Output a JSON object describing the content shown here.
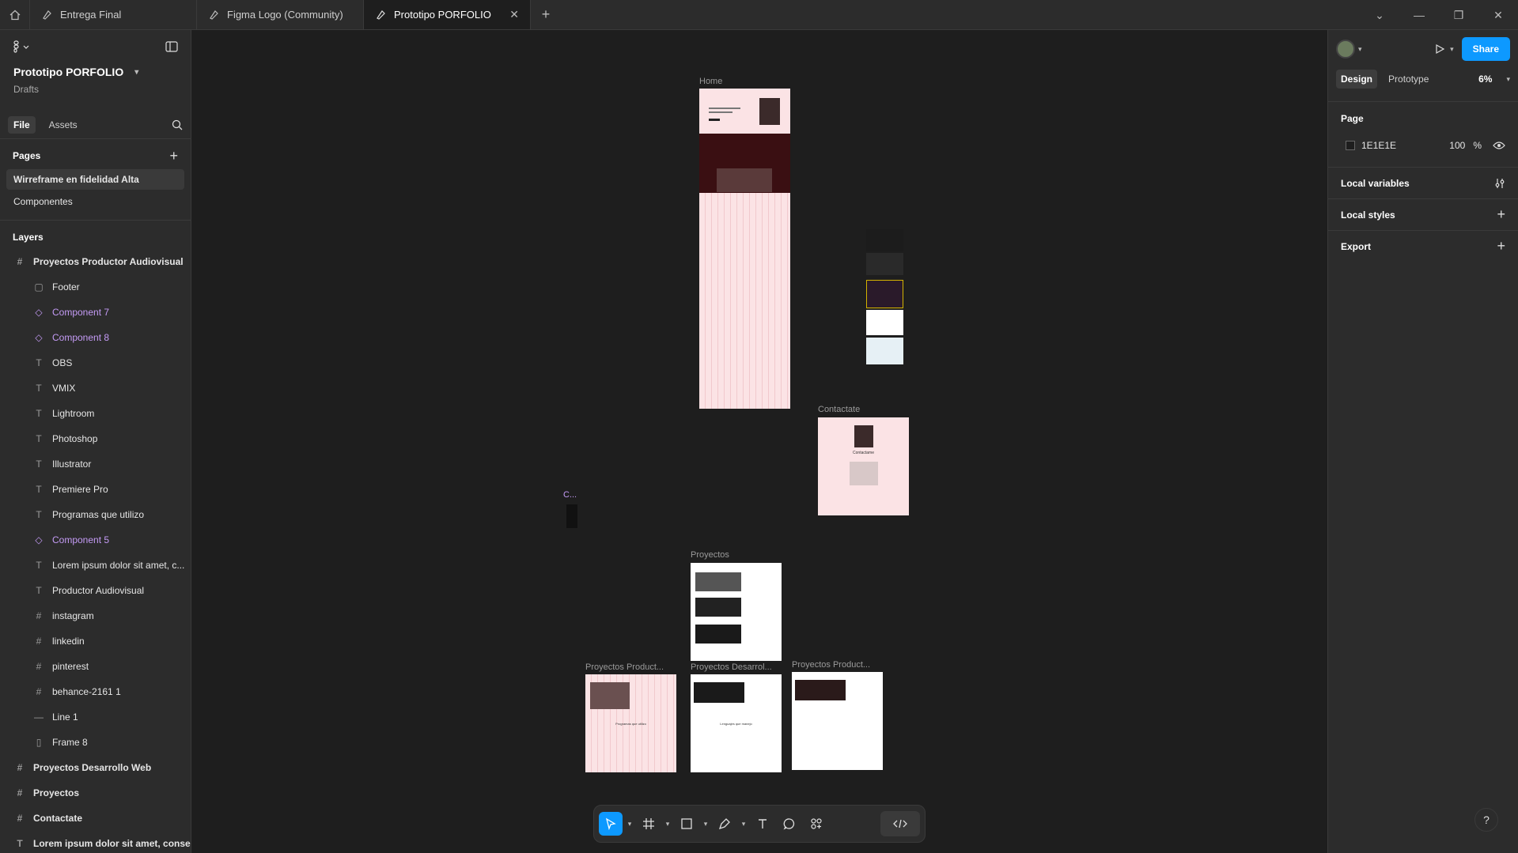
{
  "tabs": [
    {
      "label": "Entrega Final",
      "active": false
    },
    {
      "label": "Figma Logo (Community)",
      "active": false
    },
    {
      "label": "Prototipo PORFOLIO",
      "active": true
    }
  ],
  "left_panel": {
    "file_title": "Prototipo PORFOLIO",
    "file_subtitle": "Drafts",
    "tabs": {
      "file": "File",
      "assets": "Assets"
    },
    "pages_title": "Pages",
    "pages": [
      {
        "label": "Wirreframe en fidelidad Alta",
        "active": true
      },
      {
        "label": "Componentes",
        "active": false
      }
    ],
    "layers_title": "Layers",
    "layers": [
      {
        "label": "Proyectos Productor Audiovisual",
        "type": "frame",
        "level": 0
      },
      {
        "label": "Footer",
        "type": "rect",
        "level": 1
      },
      {
        "label": "Component 7",
        "type": "component",
        "level": 1
      },
      {
        "label": "Component 8",
        "type": "component",
        "level": 1
      },
      {
        "label": "OBS",
        "type": "text",
        "level": 1
      },
      {
        "label": "VMIX",
        "type": "text",
        "level": 1
      },
      {
        "label": "Lightroom",
        "type": "text",
        "level": 1
      },
      {
        "label": "Photoshop",
        "type": "text",
        "level": 1
      },
      {
        "label": "Illustrator",
        "type": "text",
        "level": 1
      },
      {
        "label": "Premiere Pro",
        "type": "text",
        "level": 1
      },
      {
        "label": "Programas que utilizo",
        "type": "text",
        "level": 1
      },
      {
        "label": "Component 5",
        "type": "component",
        "level": 1
      },
      {
        "label": "Lorem ipsum dolor sit amet, c...",
        "type": "text",
        "level": 1
      },
      {
        "label": "Productor Audiovisual",
        "type": "text",
        "level": 1
      },
      {
        "label": "instagram",
        "type": "frame",
        "level": 1
      },
      {
        "label": "linkedin",
        "type": "frame",
        "level": 1
      },
      {
        "label": "pinterest",
        "type": "frame",
        "level": 1
      },
      {
        "label": "behance-2161 1",
        "type": "frame",
        "level": 1
      },
      {
        "label": "Line 1",
        "type": "line",
        "level": 1
      },
      {
        "label": "Frame 8",
        "type": "autolayout",
        "level": 1
      },
      {
        "label": "Proyectos Desarrollo Web",
        "type": "frame",
        "level": 0
      },
      {
        "label": "Proyectos",
        "type": "frame",
        "level": 0
      },
      {
        "label": "Contactate",
        "type": "frame",
        "level": 0
      },
      {
        "label": "Lorem ipsum dolor sit amet, conse...",
        "type": "text",
        "level": 0
      }
    ]
  },
  "canvas": {
    "frames": {
      "home": "Home",
      "contactate": "Contactate",
      "proyectos": "Proyectos",
      "proy_product": "Proyectos Product...",
      "proy_desarrollo": "Proyectos Desarrol...",
      "proy_product2": "Proyectos Product...",
      "component": "C..."
    },
    "contact_heading": "Contactame",
    "programs_heading": "Programas que utilizo",
    "languages_heading": "Lenguajes que manejo"
  },
  "right_panel": {
    "share": "Share",
    "tabs": {
      "design": "Design",
      "prototype": "Prototype"
    },
    "zoom": "6%",
    "page_section": "Page",
    "page_color": "1E1E1E",
    "page_opacity": "100",
    "percent": "%",
    "local_variables": "Local variables",
    "local_styles": "Local styles",
    "export": "Export"
  },
  "colors": {
    "accent": "#0d99ff",
    "component": "#c49bf5",
    "canvas_bg": "#1e1e1e",
    "frame_pink": "#fbe3e5"
  },
  "help": "?"
}
